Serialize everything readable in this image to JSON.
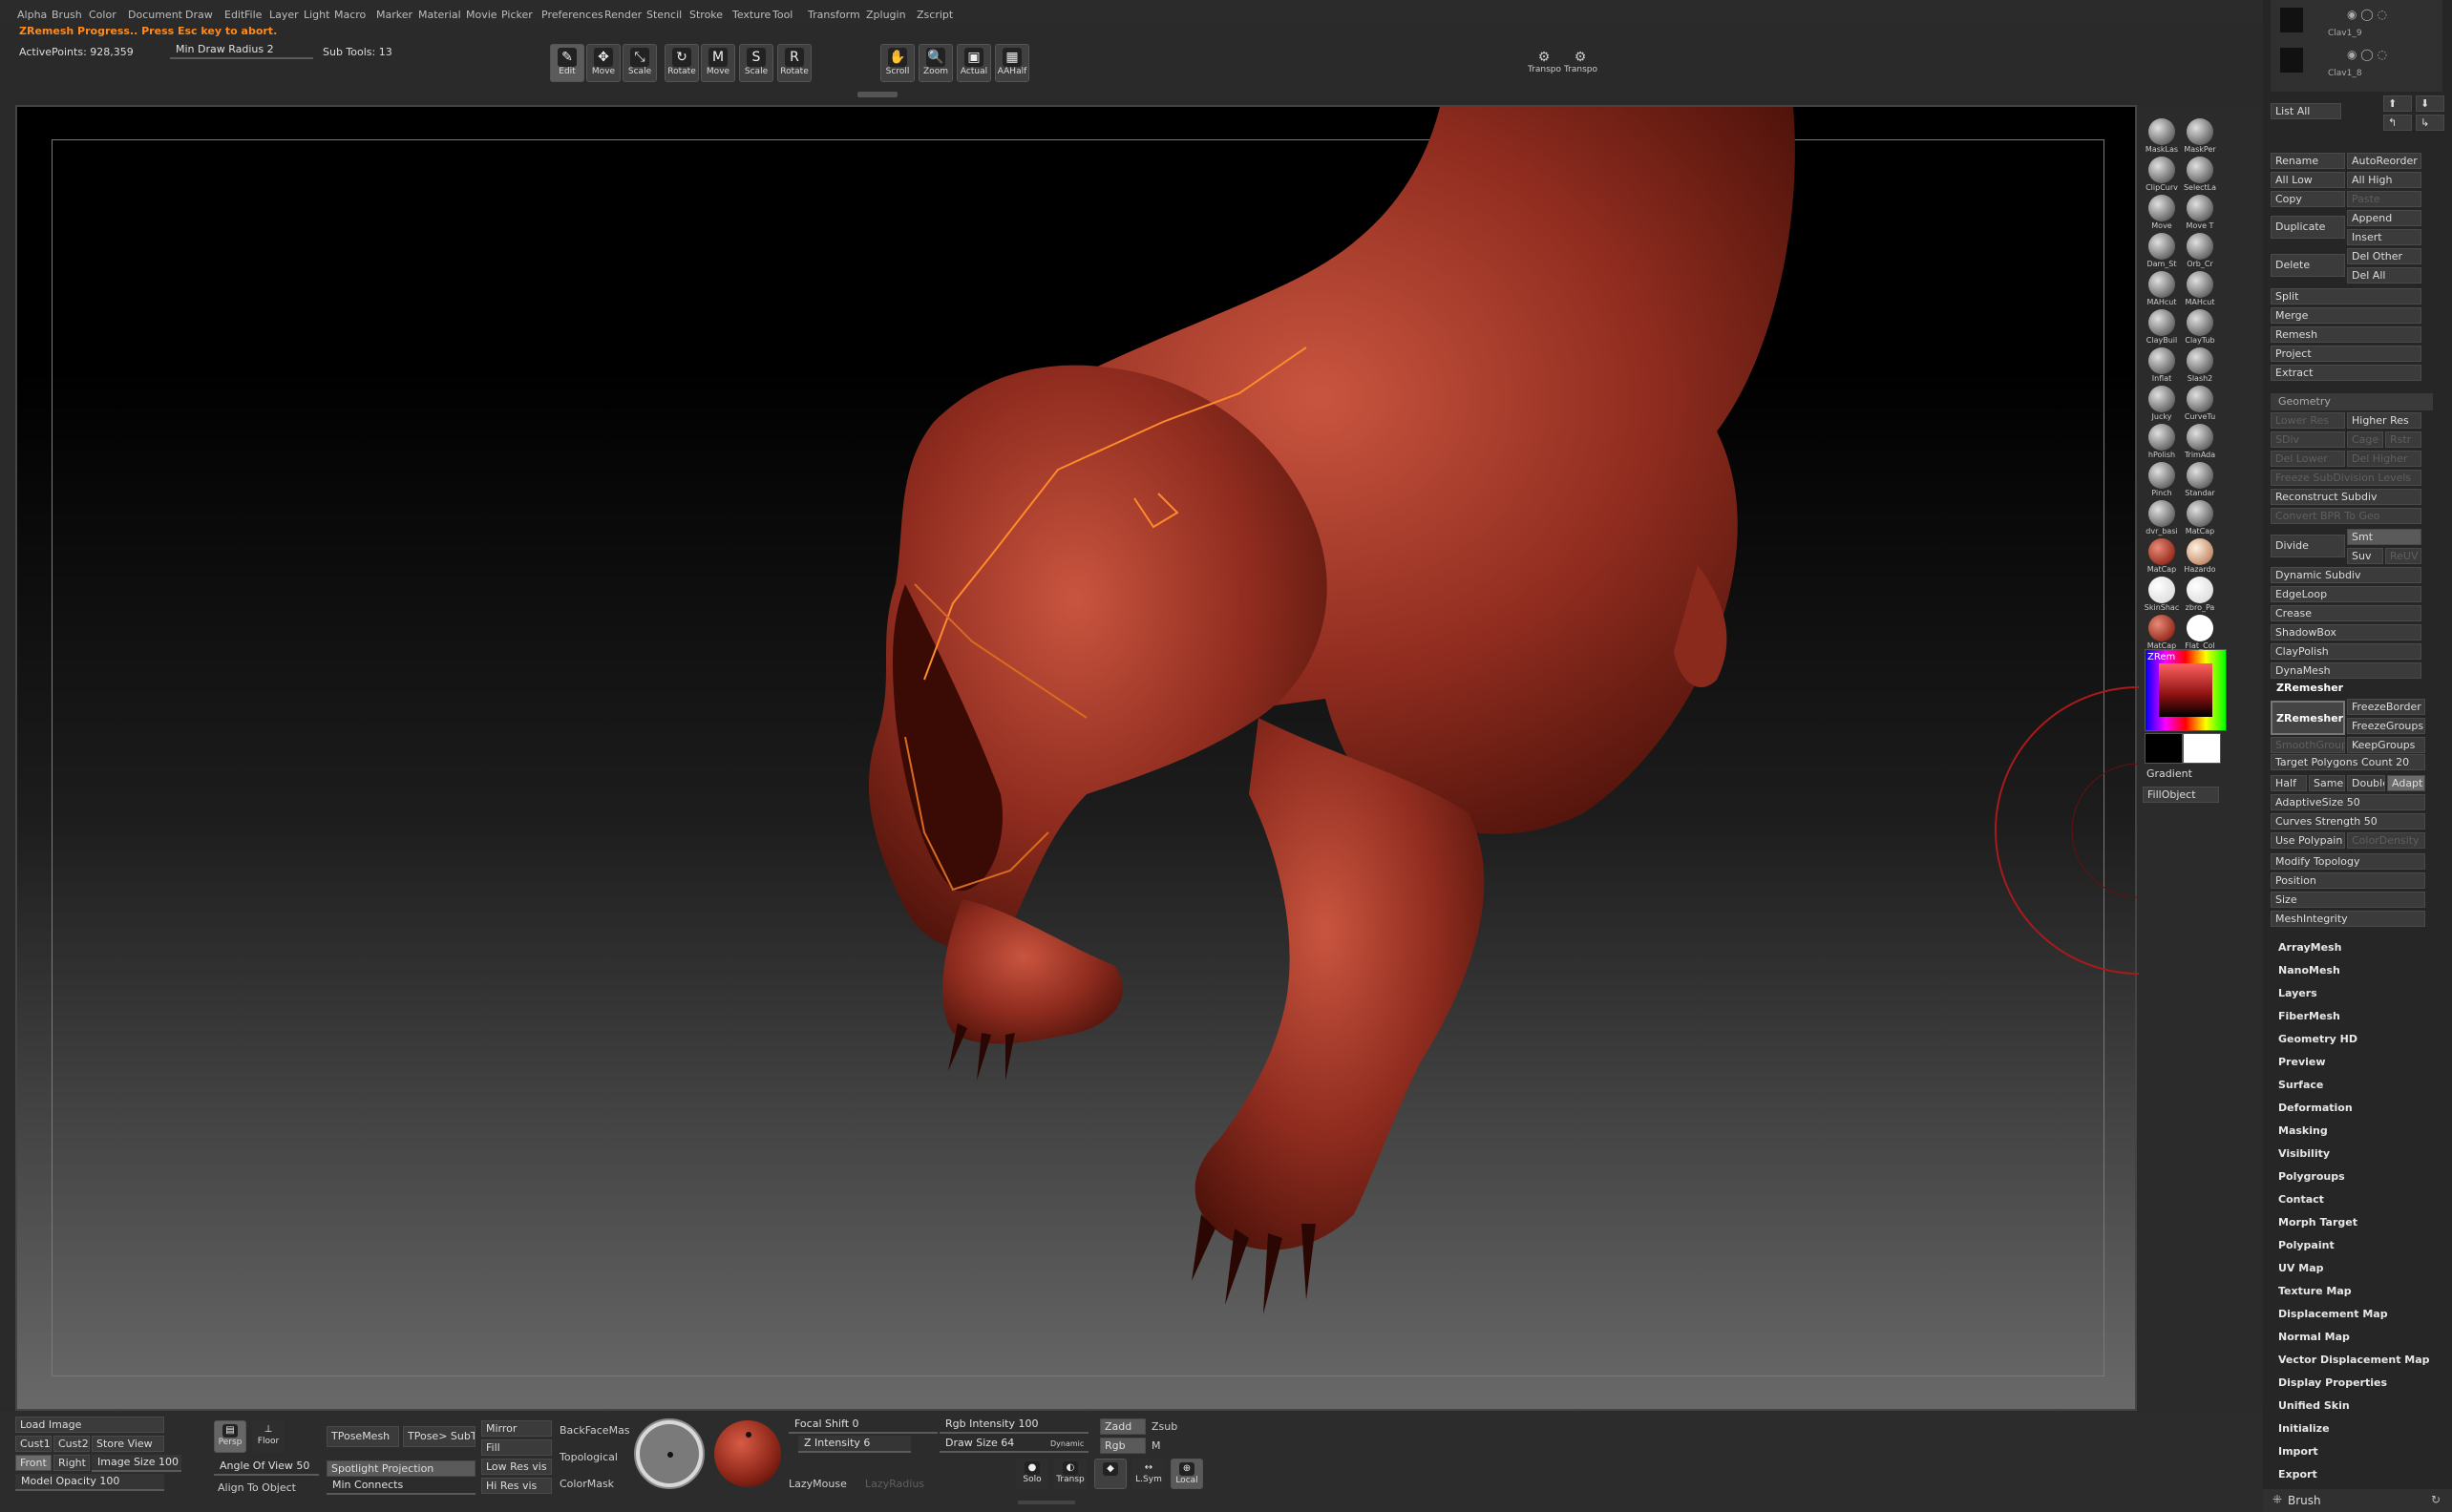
{
  "menu": [
    "Alpha",
    "Brush",
    "Color",
    "Document",
    "Draw",
    "Edit",
    "File",
    "Layer",
    "Light",
    "Macro",
    "Marker",
    "Material",
    "Movie",
    "Picker",
    "Preferences",
    "Render",
    "Stencil",
    "Stroke",
    "Texture",
    "Tool",
    "Transform",
    "Zplugin",
    "Zscript"
  ],
  "status": {
    "progress": "ZRemesh Progress.. Press Esc key to abort.",
    "active_points": "ActivePoints: 928,359",
    "min_draw_radius": "Min Draw Radius 2",
    "sub_tools": "Sub Tools: 13"
  },
  "toolbar": {
    "edit": "Edit",
    "draw": "Move",
    "move": "Scale",
    "scale": "Rotate",
    "move2": "Move",
    "scale2": "Scale",
    "rotate2": "Rotate",
    "scroll": "Scroll",
    "zoom": "Zoom",
    "actual": "Actual",
    "aahalf": "AAHalf",
    "transp1": "Transpo",
    "transp2": "Transpo"
  },
  "brushes": [
    [
      "MaskLas",
      "MaskPer"
    ],
    [
      "ClipCurv",
      "SelectLa"
    ],
    [
      "Move",
      "Move T"
    ],
    [
      "Dam_St",
      "Orb_Cr"
    ],
    [
      "MAHcut",
      "MAHcut"
    ],
    [
      "ClayBuil",
      "ClayTub"
    ],
    [
      "Inflat",
      "Slash2"
    ],
    [
      "Jucky",
      "CurveTu"
    ],
    [
      "hPolish",
      "TrimAda"
    ],
    [
      "Pinch",
      "Standar"
    ],
    [
      "dvr_basi",
      "MatCap"
    ],
    [
      "MatCap",
      "Hazardo"
    ],
    [
      "SkinShac",
      "zbro_Pa"
    ],
    [
      "MatCap",
      "Flat_Col"
    ]
  ],
  "color_picker": {
    "gradient": "Gradient",
    "fill_object": "FillObject",
    "label": "ZRem"
  },
  "subtool": {
    "clav1": "Clav1_9",
    "clav2": "Clav1_8",
    "list_all": "List All",
    "rename": "Rename",
    "auto_reorder": "AutoReorder",
    "all_low": "All Low",
    "all_high": "All High",
    "copy": "Copy",
    "paste": "Paste",
    "duplicate": "Duplicate",
    "append": "Append",
    "insert": "Insert",
    "delete": "Delete",
    "del_other": "Del Other",
    "del_all": "Del All",
    "split": "Split",
    "merge": "Merge",
    "remesh": "Remesh",
    "project": "Project",
    "extract": "Extract"
  },
  "geometry": {
    "title": "Geometry",
    "lower_res": "Lower Res",
    "higher_res": "Higher Res",
    "sdiv": "SDiv",
    "cage": "Cage",
    "rstr": "Rstr",
    "del_lower": "Del Lower",
    "del_higher": "Del Higher",
    "freeze": "Freeze SubDivision Levels",
    "reconstruct": "Reconstruct Subdiv",
    "convert_bpr": "Convert BPR To Geo",
    "divide": "Divide",
    "smt": "Smt",
    "suv": "Suv",
    "rsmt": "ReUV",
    "dynamic_subdiv": "Dynamic Subdiv",
    "edgeloop": "EdgeLoop",
    "crease": "Crease",
    "shadowbox": "ShadowBox",
    "claypolish": "ClayPolish",
    "dynamesh": "DynaMesh",
    "zremesher_section": "ZRemesher",
    "zremesher_btn": "ZRemesher",
    "freeze_border": "FreezeBorder",
    "freeze_groups": "FreezeGroups",
    "smooth_groups": "SmoothGroups",
    "keep_groups": "KeepGroups",
    "target_polygons": "Target Polygons Count 20",
    "half": "Half",
    "same": "Same",
    "double": "Double",
    "adapt": "Adapt",
    "adaptive_size": "AdaptiveSize 50",
    "curves_strength": "Curves Strength 50",
    "use_polypaint": "Use Polypain",
    "color_density": "ColorDensity",
    "modify_topology": "Modify Topology",
    "position": "Position",
    "size": "Size",
    "mesh_integrity": "MeshIntegrity"
  },
  "tool_sections": [
    "ArrayMesh",
    "NanoMesh",
    "Layers",
    "FiberMesh",
    "Geometry HD",
    "Preview",
    "Surface",
    "Deformation",
    "Masking",
    "Visibility",
    "Polygroups",
    "Contact",
    "Morph Target",
    "Polypaint",
    "UV Map",
    "Texture Map",
    "Displacement Map",
    "Normal Map",
    "Vector Displacement Map",
    "Display Properties",
    "Unified Skin",
    "Initialize",
    "Import",
    "Export"
  ],
  "brush_footer": "Brush",
  "bottom": {
    "load_image": "Load Image",
    "cust1": "Cust1",
    "cust2": "Cust2",
    "store_view": "Store View",
    "front": "Front",
    "right": "Right",
    "image_size": "Image Size 100",
    "model_opacity": "Model Opacity 100",
    "persp": "Persp",
    "floor": "Floor",
    "angle_of_view": "Angle Of View 50",
    "align_to_object": "Align To Object",
    "tposemesh": "TPoseMesh",
    "tpose_subt": "TPose> SubT",
    "spotlight_projection": "Spotlight Projection",
    "min_connects": "Min Connects",
    "mirror": "Mirror",
    "fill": "Fill",
    "low_res_vis": "Low Res vis",
    "hi_res_vis": "Hi Res vis",
    "backface_mask": "BackFaceMas",
    "topological": "Topological",
    "colormask": "ColorMask",
    "focal_shift": "Focal Shift 0",
    "z_intensity": "Z Intensity 6",
    "lazymouse": "LazyMouse",
    "lazyradius": "LazyRadius",
    "rgb_intensity": "Rgb Intensity 100",
    "draw_size": "Draw Size 64",
    "dynamic": "Dynamic",
    "zadd": "Zadd",
    "zsub": "Zsub",
    "rgb": "Rgb",
    "m": "M",
    "solo": "Solo",
    "transp": "Transp",
    "lsym": "L.Sym",
    "local": "Local",
    "dynamic_small": "Dynamic"
  }
}
